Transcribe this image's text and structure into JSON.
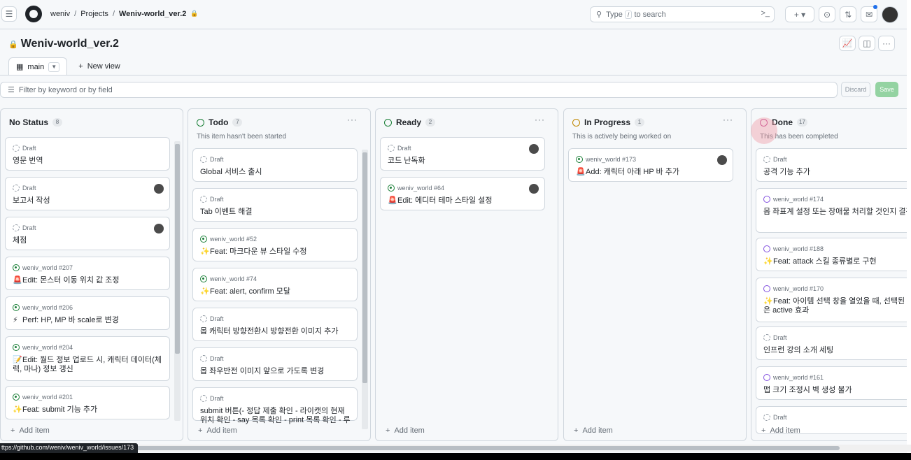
{
  "topbar": {
    "org": "weniv",
    "projects": "Projects",
    "project": "Weniv-world_ver.2",
    "search_placeholder_pre": "Type",
    "search_key": "/",
    "search_placeholder_post": "to search",
    "terminal": ">_"
  },
  "header": {
    "title": "Weniv-world_ver.2",
    "view_tab": "main",
    "new_view": "New view"
  },
  "filter": {
    "placeholder": "Filter by keyword or by field",
    "discard": "Discard",
    "save": "Save"
  },
  "columns": [
    {
      "name": "No Status",
      "count": "8",
      "desc": "",
      "cards": [
        {
          "meta": "Draft",
          "title": "영문 번역",
          "state": "draft",
          "avatar": false
        },
        {
          "meta": "Draft",
          "title": "보고서 작성",
          "state": "draft",
          "avatar": true
        },
        {
          "meta": "Draft",
          "title": "체점",
          "state": "draft",
          "avatar": true
        },
        {
          "meta": "weniv_world #207",
          "title": "Edit: 몬스터 이동 위치 값 조정",
          "state": "open",
          "avatar": false,
          "emoji": "🚨"
        },
        {
          "meta": "weniv_world #206",
          "title": "Perf: HP, MP 바 scale로 변경",
          "state": "open",
          "avatar": false,
          "emoji": "⚡"
        },
        {
          "meta": "weniv_world #204",
          "title": "Edit: 월드 정보 업로드 시, 캐릭터 데이터(체력, 마나) 정보 갱신",
          "state": "open",
          "avatar": false,
          "emoji": "📝"
        },
        {
          "meta": "weniv_world #201",
          "title": "Feat: submit 기능 추가",
          "state": "open",
          "avatar": false,
          "emoji": "✨"
        }
      ]
    },
    {
      "name": "Todo",
      "count": "7",
      "desc": "This item hasn't been started",
      "cards": [
        {
          "meta": "Draft",
          "title": "Global 서비스 출시",
          "state": "draft"
        },
        {
          "meta": "Draft",
          "title": "Tab 이벤트 해결",
          "state": "draft"
        },
        {
          "meta": "weniv_world #52",
          "title": "Feat: 마크다운 뷰 스타일 수정",
          "state": "open",
          "emoji": "✨"
        },
        {
          "meta": "weniv_world #74",
          "title": "Feat: alert, confirm 모달",
          "state": "open",
          "emoji": "✨"
        },
        {
          "meta": "Draft",
          "title": "몹 캐릭터 방향전환시 방향전환 이미지 추가",
          "state": "draft"
        },
        {
          "meta": "Draft",
          "title": "몹 좌우반전 이미지 앞으로 가도록 변경",
          "state": "draft"
        },
        {
          "meta": "Draft",
          "title": "submit 버튼(- 정답 제출 확인 - 라이캣의 현재 위치 확인 - say 목록 확인 - print 목록 확인 - 루",
          "state": "draft"
        }
      ]
    },
    {
      "name": "Ready",
      "count": "2",
      "desc": "",
      "cards": [
        {
          "meta": "Draft",
          "title": "코드 난독화",
          "state": "draft",
          "avatar": true
        },
        {
          "meta": "weniv_world #64",
          "title": "Edit: 에디터 테마 스타일 설정",
          "state": "open",
          "avatar": true,
          "emoji": "🚨"
        }
      ]
    },
    {
      "name": "In Progress",
      "count": "1",
      "desc": "This is actively being worked on",
      "cards": [
        {
          "meta": "weniv_world #173",
          "title": "Add: 캐릭터 아래 HP 바 추가",
          "state": "open",
          "avatar": true,
          "emoji": "🚨"
        }
      ]
    },
    {
      "name": "Done",
      "count": "17",
      "desc": "This has been completed",
      "cards": [
        {
          "meta": "Draft",
          "title": "공격 기능 추가",
          "state": "draft"
        },
        {
          "meta": "weniv_world #174",
          "title": "몹 좌표계 설정 또는 장애물 처리할 것인지 결정",
          "state": "done"
        },
        {
          "meta": "weniv_world #188",
          "title": "Feat: attack 스킬 종류별로 구현",
          "state": "done",
          "emoji": "✨"
        },
        {
          "meta": "weniv_world #170",
          "title": "Feat: 아이템 선택 창을 열었을 때, 선택된 아이템은 active 효과",
          "state": "done",
          "emoji": "✨"
        },
        {
          "meta": "Draft",
          "title": "인프런 강의 소개 세팅",
          "state": "draft"
        },
        {
          "meta": "weniv_world #161",
          "title": "맵 크기 조정시 벽 생성 불가",
          "state": "done"
        },
        {
          "meta": "Draft",
          "title": "",
          "state": "draft"
        }
      ]
    }
  ],
  "add_item": "Add item",
  "status_url": "ttps://github.com/weniv/weniv_world/issues/173"
}
